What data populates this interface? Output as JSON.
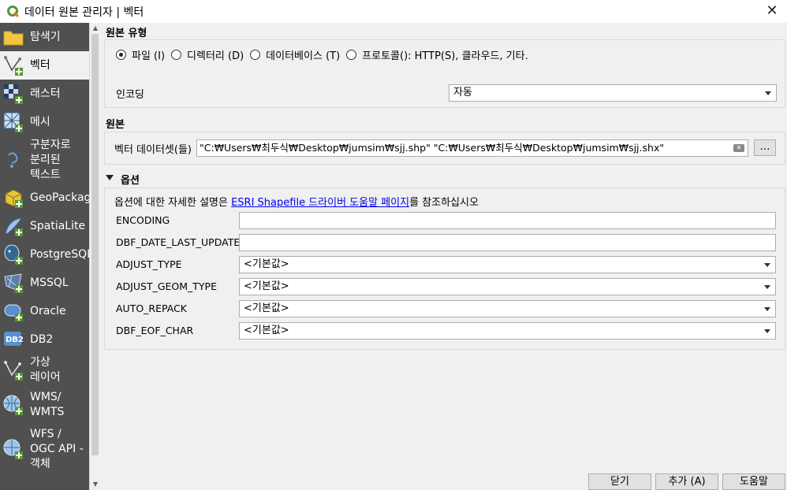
{
  "window": {
    "title": "데이터 원본 관리자 | 벡터"
  },
  "sidebar": {
    "items": [
      {
        "label": "탐색기",
        "icon": "folder-icon"
      },
      {
        "label": "벡터",
        "icon": "vector-add-icon"
      },
      {
        "label": "래스터",
        "icon": "raster-add-icon"
      },
      {
        "label": "메시",
        "icon": "mesh-add-icon"
      },
      {
        "label": "구분자로\n분리된\n텍스트",
        "icon": "delimited-text-icon"
      },
      {
        "label": "GeoPackage",
        "icon": "geopackage-icon"
      },
      {
        "label": "SpatiaLite",
        "icon": "spatialite-icon"
      },
      {
        "label": "PostgreSQL",
        "icon": "postgresql-icon"
      },
      {
        "label": "MSSQL",
        "icon": "mssql-icon"
      },
      {
        "label": "Oracle",
        "icon": "oracle-icon"
      },
      {
        "label": "DB2",
        "icon": "db2-icon"
      },
      {
        "label": "가상\n레이어",
        "icon": "virtual-layer-icon"
      },
      {
        "label": "WMS/\nWMTS",
        "icon": "wms-icon"
      },
      {
        "label": "WFS /\nOGC API -\n객체",
        "icon": "wfs-icon"
      }
    ]
  },
  "source_type": {
    "title": "원본 유형",
    "options": [
      "파일 (I)",
      "디렉터리 (D)",
      "데이터베이스 (T)",
      "프로토콜(): HTTP(S), 클라우드, 기타."
    ],
    "selected_index": 0,
    "encoding_label": "인코딩",
    "encoding_value": "자동"
  },
  "source": {
    "title": "원본",
    "dataset_label": "벡터 데이터셋(들)",
    "dataset_value": "\"C:₩Users₩최두식₩Desktop₩jumsim₩sjj.shp\" \"C:₩Users₩최두식₩Desktop₩jumsim₩sjj.shx\"",
    "browse_label": "…"
  },
  "options": {
    "title": "옵션",
    "help_prefix": "옵션에 대한 자세한 설명은 ",
    "help_link": "ESRI Shapefile 드라이버 도움말 페이지",
    "help_suffix": "를 참조하십시오",
    "fields": [
      {
        "label": "ENCODING",
        "kind": "text",
        "value": ""
      },
      {
        "label": "DBF_DATE_LAST_UPDATE",
        "kind": "text",
        "value": ""
      },
      {
        "label": "ADJUST_TYPE",
        "kind": "combo",
        "value": "<기본값>"
      },
      {
        "label": "ADJUST_GEOM_TYPE",
        "kind": "combo",
        "value": "<기본값>"
      },
      {
        "label": "AUTO_REPACK",
        "kind": "combo",
        "value": "<기본값>"
      },
      {
        "label": "DBF_EOF_CHAR",
        "kind": "combo",
        "value": "<기본값>"
      }
    ]
  },
  "buttons": {
    "close": "닫기",
    "add": "추가 (A)",
    "help": "도움말"
  },
  "colors": {
    "sidebar_bg": "#505050",
    "link": "#0000ee",
    "qgis_green": "#589632"
  }
}
